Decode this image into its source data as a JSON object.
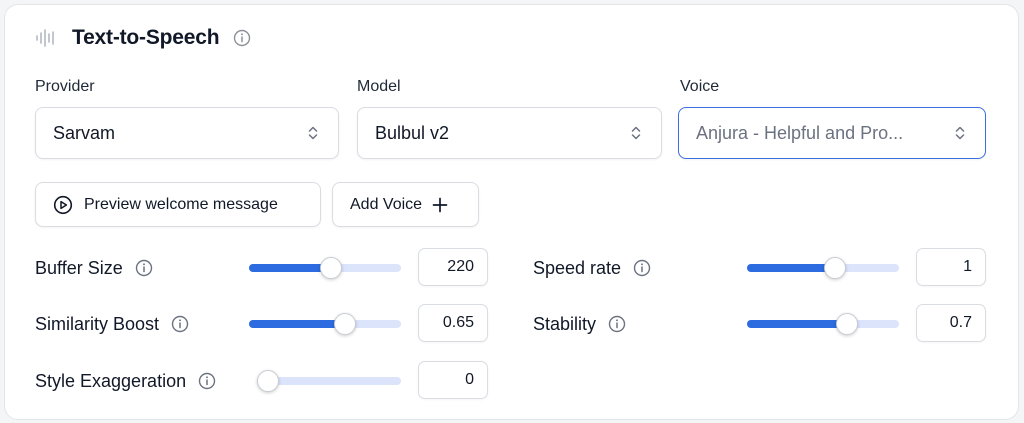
{
  "section": {
    "title": "Text-to-Speech"
  },
  "fields": {
    "provider": {
      "label": "Provider",
      "value": "Sarvam"
    },
    "model": {
      "label": "Model",
      "value": "Bulbul v2"
    },
    "voice": {
      "label": "Voice",
      "value": "Anjura - Helpful and Pro..."
    }
  },
  "buttons": {
    "preview": "Preview welcome message",
    "add_voice": "Add Voice"
  },
  "params": {
    "buffer_size": {
      "label": "Buffer Size",
      "value": "220",
      "level": 0.54
    },
    "speed_rate": {
      "label": "Speed rate",
      "value": "1",
      "level": 0.58
    },
    "similarity_boost": {
      "label": "Similarity Boost",
      "value": "0.65",
      "level": 0.63
    },
    "stability": {
      "label": "Stability",
      "value": "0.7",
      "level": 0.66
    },
    "style_exaggeration": {
      "label": "Style Exaggeration",
      "value": "0",
      "level": 0.0
    }
  },
  "colors": {
    "accent": "#2c6be0",
    "track": "#dbe4fb",
    "focus_border": "#3b6fe0"
  },
  "icons": {
    "header": "audio-wave-icon",
    "info": "info-circle-icon",
    "select": "chevron-up-down-icon",
    "preview": "play-circle-icon",
    "add": "plus-icon"
  }
}
